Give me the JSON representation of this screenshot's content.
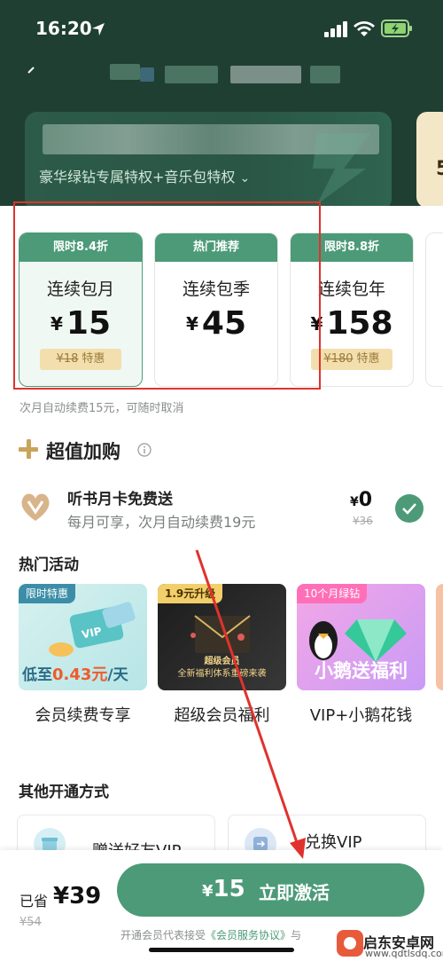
{
  "status_bar": {
    "time": "16:20"
  },
  "header": {
    "privilege_text": "豪华绿钻专属特权+音乐包特权",
    "side_card_number": "5"
  },
  "plans": [
    {
      "tag": "限时8.4折",
      "name": "连续包月",
      "currency": "¥",
      "price": "15",
      "old_price": "¥18",
      "deal": "特惠",
      "selected": true
    },
    {
      "tag": "热门推荐",
      "name": "连续包季",
      "currency": "¥",
      "price": "45"
    },
    {
      "tag": "限时8.8折",
      "name": "连续包年",
      "currency": "¥",
      "price": "158",
      "old_price": "¥180",
      "deal": "特惠"
    }
  ],
  "renew_note": "次月自动续费15元，可随时取消",
  "addon": {
    "section_title": "超值加购",
    "title": "听书月卡免费送",
    "subtitle": "每月可享，次月自动续费19元",
    "currency": "¥",
    "price": "0",
    "old_price": "¥36",
    "checked": true
  },
  "activities": {
    "section_title": "热门活动",
    "items": [
      {
        "badge": "限时特惠",
        "art_text_prefix": "低至",
        "art_text_highlight": "0.43元",
        "art_text_suffix": "/天",
        "label": "会员续费专享"
      },
      {
        "badge": "1.9元升级",
        "art_text1": "超级会员",
        "art_text2": "全新福利体系重磅来袭",
        "label": "超级会员福利"
      },
      {
        "badge": "10个月绿钻",
        "art_text": "小鹅送福利",
        "label": "VIP+小鹅花钱"
      }
    ]
  },
  "other_ways": {
    "section_title": "其他开通方式",
    "items": [
      {
        "label": "赠送好友VIP"
      },
      {
        "label": "兑换VIP"
      }
    ]
  },
  "bottom_bar": {
    "save_label": "已省",
    "save_amount": "¥39",
    "save_old": "¥54",
    "cta_currency": "¥",
    "cta_price": "15",
    "cta_label": "立即激活",
    "agreement_prefix": "开通会员代表接受",
    "agreement_link": "《会员服务协议》",
    "agreement_suffix": "与"
  },
  "watermark": {
    "name": "启东安卓网",
    "url": "www.qdtlsdq.com"
  },
  "colors": {
    "header_bg": "#1f3f33",
    "accent_green": "#4c9a78",
    "deal_bg": "#f3dfae",
    "annotation_red": "#e0322d"
  }
}
